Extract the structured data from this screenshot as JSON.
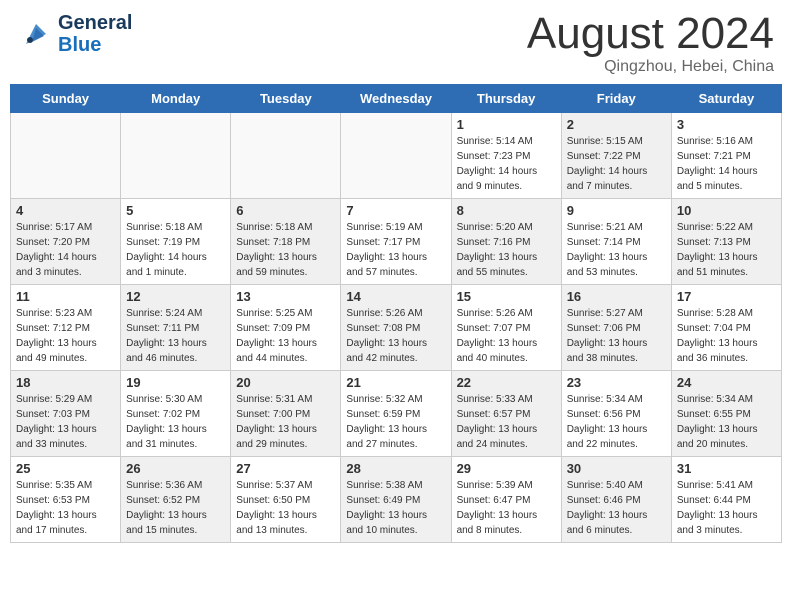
{
  "header": {
    "logo_line1": "General",
    "logo_line2": "Blue",
    "title": "August 2024",
    "location": "Qingzhou, Hebei, China"
  },
  "days_of_week": [
    "Sunday",
    "Monday",
    "Tuesday",
    "Wednesday",
    "Thursday",
    "Friday",
    "Saturday"
  ],
  "weeks": [
    [
      {
        "day": "",
        "info": "",
        "shaded": true
      },
      {
        "day": "",
        "info": "",
        "shaded": true
      },
      {
        "day": "",
        "info": "",
        "shaded": true
      },
      {
        "day": "",
        "info": "",
        "shaded": true
      },
      {
        "day": "1",
        "info": "Sunrise: 5:14 AM\nSunset: 7:23 PM\nDaylight: 14 hours\nand 9 minutes.",
        "shaded": false
      },
      {
        "day": "2",
        "info": "Sunrise: 5:15 AM\nSunset: 7:22 PM\nDaylight: 14 hours\nand 7 minutes.",
        "shaded": true
      },
      {
        "day": "3",
        "info": "Sunrise: 5:16 AM\nSunset: 7:21 PM\nDaylight: 14 hours\nand 5 minutes.",
        "shaded": false
      }
    ],
    [
      {
        "day": "4",
        "info": "Sunrise: 5:17 AM\nSunset: 7:20 PM\nDaylight: 14 hours\nand 3 minutes.",
        "shaded": true
      },
      {
        "day": "5",
        "info": "Sunrise: 5:18 AM\nSunset: 7:19 PM\nDaylight: 14 hours\nand 1 minute.",
        "shaded": false
      },
      {
        "day": "6",
        "info": "Sunrise: 5:18 AM\nSunset: 7:18 PM\nDaylight: 13 hours\nand 59 minutes.",
        "shaded": true
      },
      {
        "day": "7",
        "info": "Sunrise: 5:19 AM\nSunset: 7:17 PM\nDaylight: 13 hours\nand 57 minutes.",
        "shaded": false
      },
      {
        "day": "8",
        "info": "Sunrise: 5:20 AM\nSunset: 7:16 PM\nDaylight: 13 hours\nand 55 minutes.",
        "shaded": true
      },
      {
        "day": "9",
        "info": "Sunrise: 5:21 AM\nSunset: 7:14 PM\nDaylight: 13 hours\nand 53 minutes.",
        "shaded": false
      },
      {
        "day": "10",
        "info": "Sunrise: 5:22 AM\nSunset: 7:13 PM\nDaylight: 13 hours\nand 51 minutes.",
        "shaded": true
      }
    ],
    [
      {
        "day": "11",
        "info": "Sunrise: 5:23 AM\nSunset: 7:12 PM\nDaylight: 13 hours\nand 49 minutes.",
        "shaded": false
      },
      {
        "day": "12",
        "info": "Sunrise: 5:24 AM\nSunset: 7:11 PM\nDaylight: 13 hours\nand 46 minutes.",
        "shaded": true
      },
      {
        "day": "13",
        "info": "Sunrise: 5:25 AM\nSunset: 7:09 PM\nDaylight: 13 hours\nand 44 minutes.",
        "shaded": false
      },
      {
        "day": "14",
        "info": "Sunrise: 5:26 AM\nSunset: 7:08 PM\nDaylight: 13 hours\nand 42 minutes.",
        "shaded": true
      },
      {
        "day": "15",
        "info": "Sunrise: 5:26 AM\nSunset: 7:07 PM\nDaylight: 13 hours\nand 40 minutes.",
        "shaded": false
      },
      {
        "day": "16",
        "info": "Sunrise: 5:27 AM\nSunset: 7:06 PM\nDaylight: 13 hours\nand 38 minutes.",
        "shaded": true
      },
      {
        "day": "17",
        "info": "Sunrise: 5:28 AM\nSunset: 7:04 PM\nDaylight: 13 hours\nand 36 minutes.",
        "shaded": false
      }
    ],
    [
      {
        "day": "18",
        "info": "Sunrise: 5:29 AM\nSunset: 7:03 PM\nDaylight: 13 hours\nand 33 minutes.",
        "shaded": true
      },
      {
        "day": "19",
        "info": "Sunrise: 5:30 AM\nSunset: 7:02 PM\nDaylight: 13 hours\nand 31 minutes.",
        "shaded": false
      },
      {
        "day": "20",
        "info": "Sunrise: 5:31 AM\nSunset: 7:00 PM\nDaylight: 13 hours\nand 29 minutes.",
        "shaded": true
      },
      {
        "day": "21",
        "info": "Sunrise: 5:32 AM\nSunset: 6:59 PM\nDaylight: 13 hours\nand 27 minutes.",
        "shaded": false
      },
      {
        "day": "22",
        "info": "Sunrise: 5:33 AM\nSunset: 6:57 PM\nDaylight: 13 hours\nand 24 minutes.",
        "shaded": true
      },
      {
        "day": "23",
        "info": "Sunrise: 5:34 AM\nSunset: 6:56 PM\nDaylight: 13 hours\nand 22 minutes.",
        "shaded": false
      },
      {
        "day": "24",
        "info": "Sunrise: 5:34 AM\nSunset: 6:55 PM\nDaylight: 13 hours\nand 20 minutes.",
        "shaded": true
      }
    ],
    [
      {
        "day": "25",
        "info": "Sunrise: 5:35 AM\nSunset: 6:53 PM\nDaylight: 13 hours\nand 17 minutes.",
        "shaded": false
      },
      {
        "day": "26",
        "info": "Sunrise: 5:36 AM\nSunset: 6:52 PM\nDaylight: 13 hours\nand 15 minutes.",
        "shaded": true
      },
      {
        "day": "27",
        "info": "Sunrise: 5:37 AM\nSunset: 6:50 PM\nDaylight: 13 hours\nand 13 minutes.",
        "shaded": false
      },
      {
        "day": "28",
        "info": "Sunrise: 5:38 AM\nSunset: 6:49 PM\nDaylight: 13 hours\nand 10 minutes.",
        "shaded": true
      },
      {
        "day": "29",
        "info": "Sunrise: 5:39 AM\nSunset: 6:47 PM\nDaylight: 13 hours\nand 8 minutes.",
        "shaded": false
      },
      {
        "day": "30",
        "info": "Sunrise: 5:40 AM\nSunset: 6:46 PM\nDaylight: 13 hours\nand 6 minutes.",
        "shaded": true
      },
      {
        "day": "31",
        "info": "Sunrise: 5:41 AM\nSunset: 6:44 PM\nDaylight: 13 hours\nand 3 minutes.",
        "shaded": false
      }
    ]
  ],
  "colors": {
    "header_bg": "#2e6db4",
    "header_text": "#ffffff",
    "shaded_cell": "#f0f0f0",
    "white_cell": "#ffffff",
    "empty_cell": "#f9f9f9",
    "border": "#cccccc",
    "title_color": "#333333",
    "location_color": "#555555",
    "logo_dark": "#1a3a5c",
    "logo_blue": "#1a6fbb"
  }
}
